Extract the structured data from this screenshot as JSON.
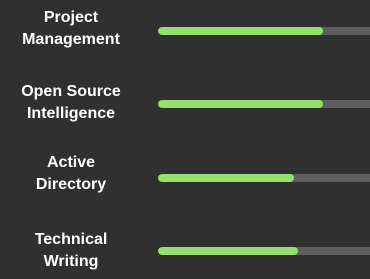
{
  "colors": {
    "background": "#303030",
    "bar_fill": "#93e06f",
    "bar_track": "#5e5e5e",
    "label_text": "#ffffff"
  },
  "skills": [
    {
      "label": "Project\nManagement",
      "level": 0.78
    },
    {
      "label": "Open Source\nIntelligence",
      "level": 0.78
    },
    {
      "label": "Active\nDirectory",
      "level": 0.64
    },
    {
      "label": "Technical\nWriting",
      "level": 0.66
    }
  ]
}
